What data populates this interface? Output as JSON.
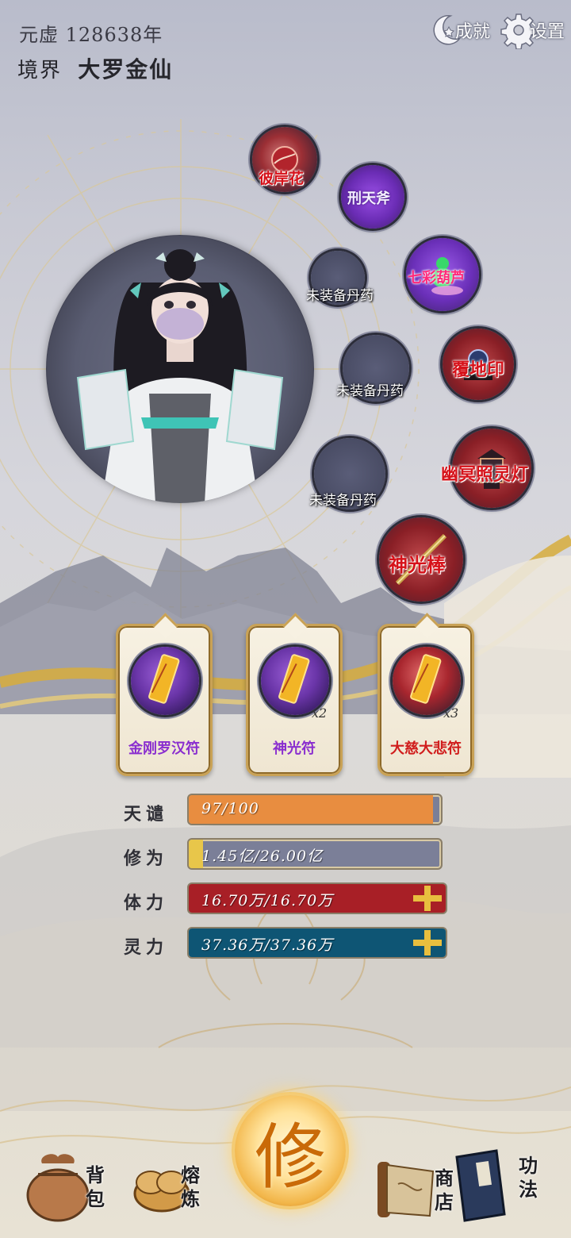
{
  "header": {
    "year_label": "元虚",
    "year_value": "128638年",
    "realm_label": "境界",
    "realm_value": "大罗金仙",
    "achievement_label": "成就",
    "settings_label": "设置"
  },
  "equipment": [
    {
      "name": "彼岸花",
      "type": "item"
    },
    {
      "name": "刑天斧",
      "type": "item"
    },
    {
      "name": "七彩葫芦",
      "type": "item"
    },
    {
      "name": "覆地印",
      "type": "item"
    },
    {
      "name": "幽冥照灵灯",
      "type": "item"
    },
    {
      "name": "神光棒",
      "type": "item"
    }
  ],
  "pill_slots": [
    {
      "label": "未装备丹药"
    },
    {
      "label": "未装备丹药"
    },
    {
      "label": "未装备丹药"
    }
  ],
  "talismans": [
    {
      "name": "金刚罗汉符",
      "count": "",
      "color": "#8a2ecf"
    },
    {
      "name": "神光符",
      "count": "x2",
      "color": "#8a2ecf"
    },
    {
      "name": "大慈大悲符",
      "count": "x3",
      "color": "#d01c1c"
    }
  ],
  "stats": {
    "tianqian": {
      "label": "天谴",
      "text": "97/100",
      "fraction": 0.97,
      "color": "#e88d40"
    },
    "xiuwei": {
      "label": "修为",
      "text": "1.45亿/26.00亿",
      "fraction": 0.056,
      "color": "#e8c64a"
    },
    "tili": {
      "label": "体力",
      "text": "16.70万/16.70万",
      "fraction": 1.0,
      "color": "#a81f26"
    },
    "lingli": {
      "label": "灵力",
      "text": "37.36万/37.36万",
      "fraction": 1.0,
      "color": "#0e5574"
    }
  },
  "bottom_nav": {
    "cultivate_glyph": "修",
    "bag": "背包",
    "smelt": "熔炼",
    "shop": "商店",
    "skills": "功法"
  }
}
